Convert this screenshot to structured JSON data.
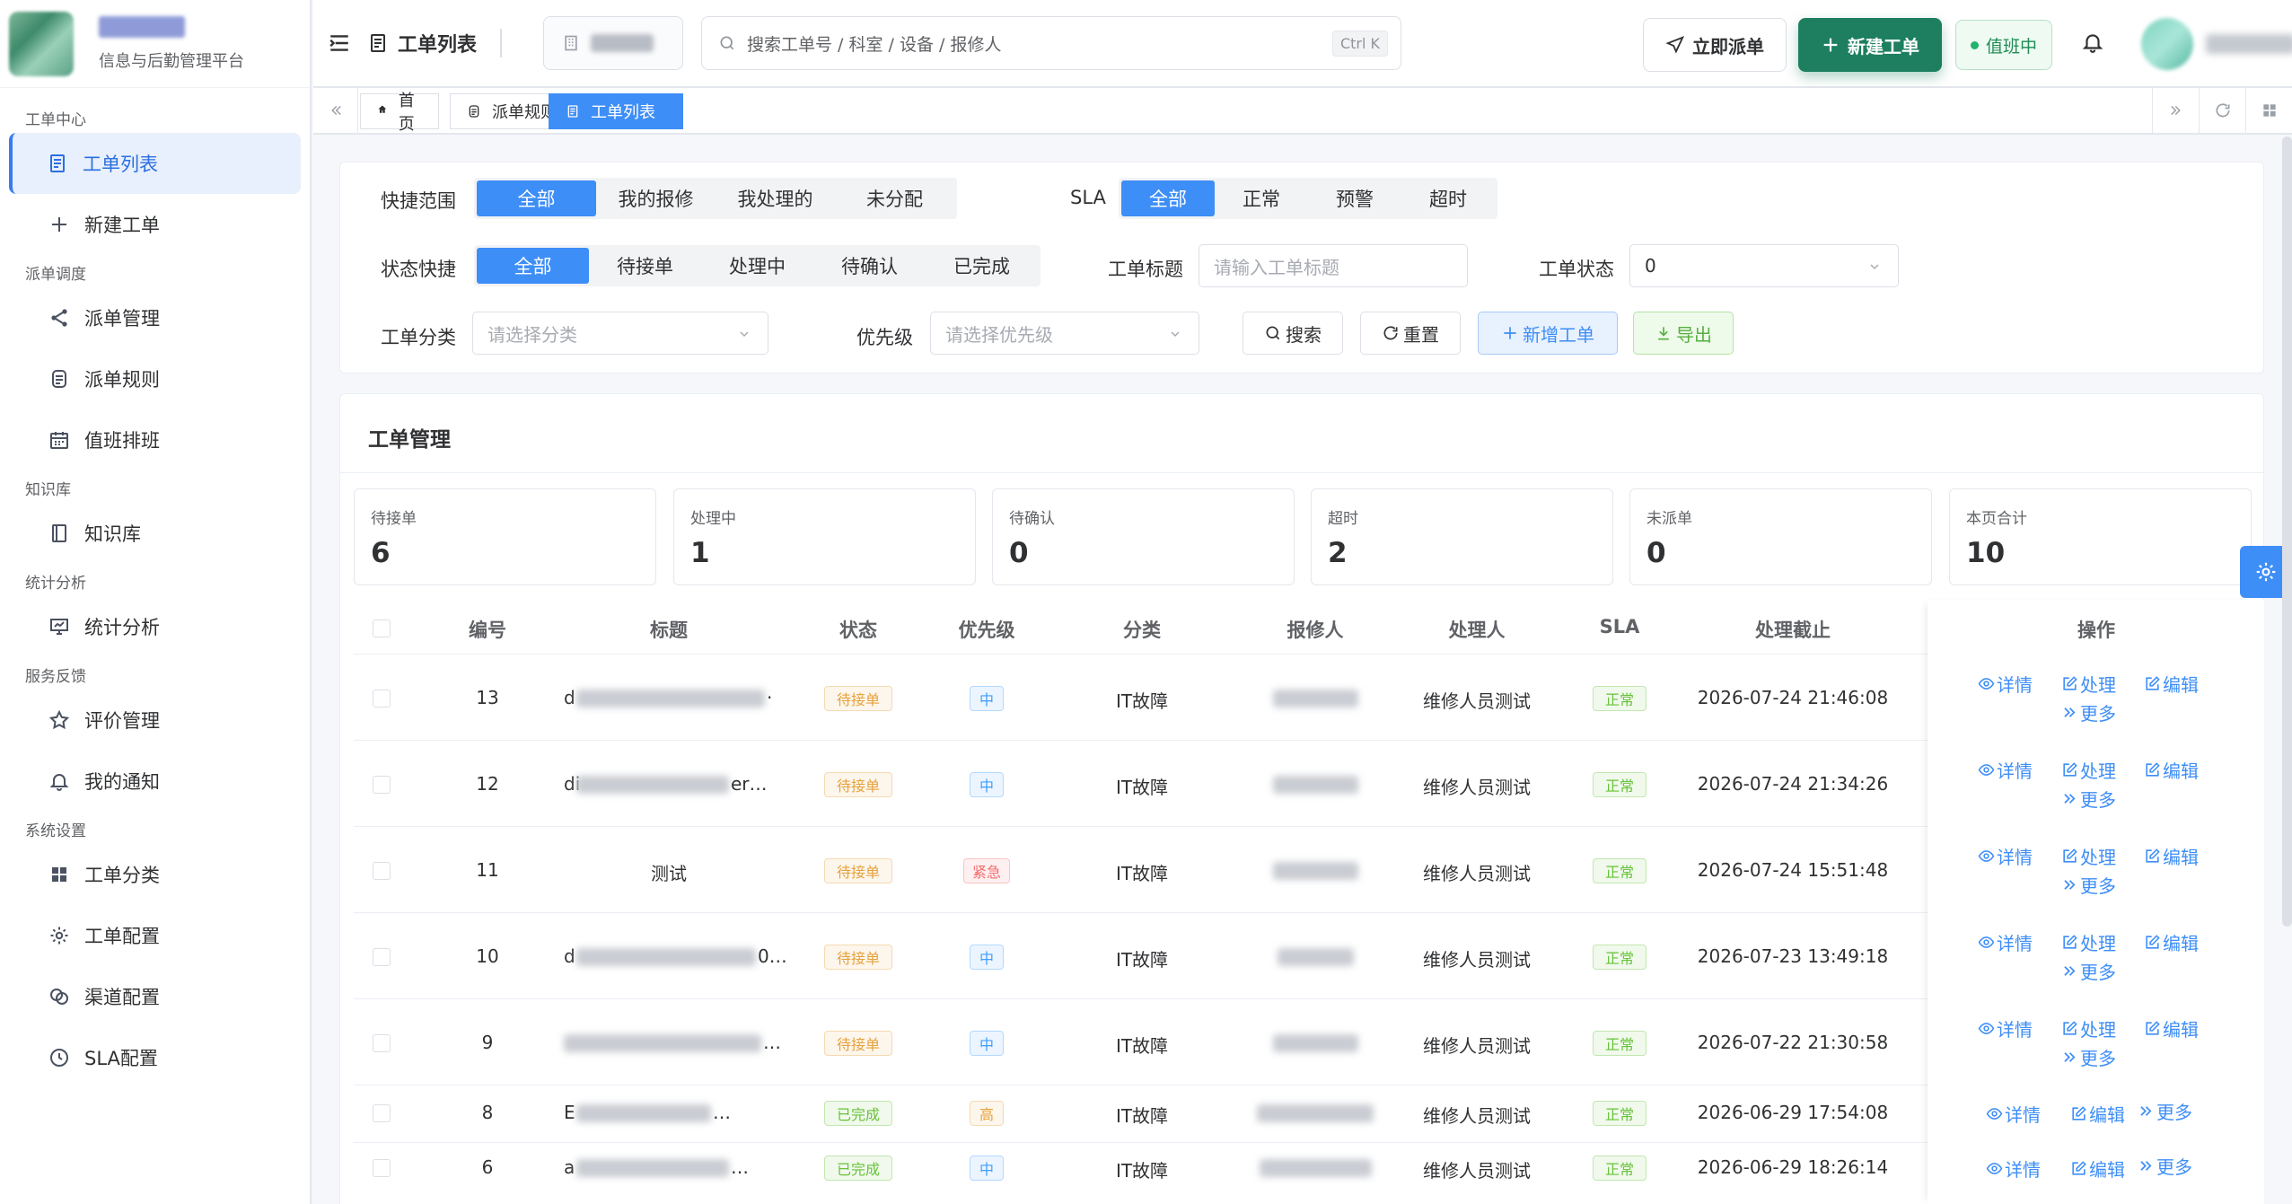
{
  "brand": {
    "subtitle": "信息与后勤管理平台"
  },
  "sidebar": {
    "groups": [
      {
        "title": "工单中心",
        "items": [
          {
            "label": "工单列表",
            "icon": "document-icon",
            "active": true
          },
          {
            "label": "新建工单",
            "icon": "plus-icon"
          }
        ]
      },
      {
        "title": "派单调度",
        "items": [
          {
            "label": "派单管理",
            "icon": "share-icon"
          },
          {
            "label": "派单规则",
            "icon": "rules-icon"
          },
          {
            "label": "值班排班",
            "icon": "calendar-icon"
          }
        ]
      },
      {
        "title": "知识库",
        "items": [
          {
            "label": "知识库",
            "icon": "book-icon"
          }
        ]
      },
      {
        "title": "统计分析",
        "items": [
          {
            "label": "统计分析",
            "icon": "chart-icon"
          }
        ]
      },
      {
        "title": "服务反馈",
        "items": [
          {
            "label": "评价管理",
            "icon": "star-icon"
          },
          {
            "label": "我的通知",
            "icon": "bell-icon"
          }
        ]
      },
      {
        "title": "系统设置",
        "items": [
          {
            "label": "工单分类",
            "icon": "grid-icon"
          },
          {
            "label": "工单配置",
            "icon": "gear-icon"
          },
          {
            "label": "渠道配置",
            "icon": "channel-icon"
          },
          {
            "label": "SLA配置",
            "icon": "sla-icon"
          }
        ]
      }
    ]
  },
  "header": {
    "title": "工单列表",
    "search_placeholder": "搜索工单号 / 科室 / 设备 / 报修人",
    "shortcut": "Ctrl K",
    "dispatch_label": "立即派单",
    "new_label": "新建工单",
    "duty_label": "值班中"
  },
  "tabs": [
    {
      "label": "首页",
      "icon": "home-icon"
    },
    {
      "label": "派单规则",
      "icon": "rules-icon"
    },
    {
      "label": "工单列表",
      "icon": "document-icon",
      "active": true
    }
  ],
  "filters": {
    "quick_scope": {
      "label": "快捷范围",
      "options": [
        "全部",
        "我的报修",
        "我处理的",
        "未分配"
      ],
      "selected": "全部"
    },
    "sla": {
      "label": "SLA",
      "options": [
        "全部",
        "正常",
        "预警",
        "超时"
      ],
      "selected": "全部"
    },
    "status_quick": {
      "label": "状态快捷",
      "options": [
        "全部",
        "待接单",
        "处理中",
        "待确认",
        "已完成"
      ],
      "selected": "全部"
    },
    "title_field": {
      "label": "工单标题",
      "placeholder": "请输入工单标题"
    },
    "status_field": {
      "label": "工单状态",
      "value": "0"
    },
    "category_field": {
      "label": "工单分类",
      "placeholder": "请选择分类"
    },
    "priority_field": {
      "label": "优先级",
      "placeholder": "请选择优先级"
    },
    "buttons": {
      "search": "搜索",
      "reset": "重置",
      "add": "新增工单",
      "export": "导出"
    }
  },
  "main": {
    "title": "工单管理",
    "stats": [
      {
        "label": "待接单",
        "value": "6"
      },
      {
        "label": "处理中",
        "value": "1"
      },
      {
        "label": "待确认",
        "value": "0"
      },
      {
        "label": "超时",
        "value": "2"
      },
      {
        "label": "未派单",
        "value": "0"
      },
      {
        "label": "本页合计",
        "value": "10"
      }
    ],
    "columns": [
      "编号",
      "标题",
      "状态",
      "优先级",
      "分类",
      "报修人",
      "处理人",
      "SLA",
      "处理截止",
      "操作"
    ],
    "rows": [
      {
        "id": "13",
        "title": "d",
        "title_tail": "·",
        "status": "待接单",
        "status_color": "orange",
        "priority": "中",
        "priority_color": "blue",
        "category": "IT故障",
        "handler": "维修人员测试",
        "sla": "正常",
        "deadline": "2026-07-24 21:46:08",
        "ops": [
          "详情",
          "处理",
          "编辑",
          "更多"
        ]
      },
      {
        "id": "12",
        "title": "di",
        "title_tail": "er…",
        "status": "待接单",
        "status_color": "orange",
        "priority": "中",
        "priority_color": "blue",
        "category": "IT故障",
        "handler": "维修人员测试",
        "sla": "正常",
        "deadline": "2026-07-24 21:34:26",
        "ops": [
          "详情",
          "处理",
          "编辑",
          "更多"
        ]
      },
      {
        "id": "11",
        "title": "测试",
        "title_tail": "",
        "status": "待接单",
        "status_color": "orange",
        "priority": "紧急",
        "priority_color": "red",
        "category": "IT故障",
        "handler": "维修人员测试",
        "sla": "正常",
        "deadline": "2026-07-24 15:51:48",
        "ops": [
          "详情",
          "处理",
          "编辑",
          "更多"
        ]
      },
      {
        "id": "10",
        "title": "d",
        "title_tail": "0…",
        "status": "待接单",
        "status_color": "orange",
        "priority": "中",
        "priority_color": "blue",
        "category": "IT故障",
        "handler": "维修人员测试",
        "sla": "正常",
        "deadline": "2026-07-23 13:49:18",
        "ops": [
          "详情",
          "处理",
          "编辑",
          "更多"
        ]
      },
      {
        "id": "9",
        "title": "",
        "title_tail": "…",
        "status": "待接单",
        "status_color": "orange",
        "priority": "中",
        "priority_color": "blue",
        "category": "IT故障",
        "handler": "维修人员测试",
        "sla": "正常",
        "deadline": "2026-07-22 21:30:58",
        "ops": [
          "详情",
          "处理",
          "编辑",
          "更多"
        ]
      },
      {
        "id": "8",
        "title": "E",
        "title_tail": "…",
        "status": "已完成",
        "status_color": "green",
        "priority": "高",
        "priority_color": "orange",
        "category": "IT故障",
        "handler": "维修人员测试",
        "sla": "正常",
        "deadline": "2026-06-29 17:54:08",
        "ops": [
          "详情",
          "编辑",
          "更多"
        ]
      },
      {
        "id": "6",
        "title": "a",
        "title_tail": "…",
        "status": "已完成",
        "status_color": "green",
        "priority": "中",
        "priority_color": "blue",
        "category": "IT故障",
        "handler": "维修人员测试",
        "sla": "正常",
        "deadline": "2026-06-29 18:26:14",
        "ops": [
          "详情",
          "编辑",
          "更多"
        ]
      }
    ]
  }
}
